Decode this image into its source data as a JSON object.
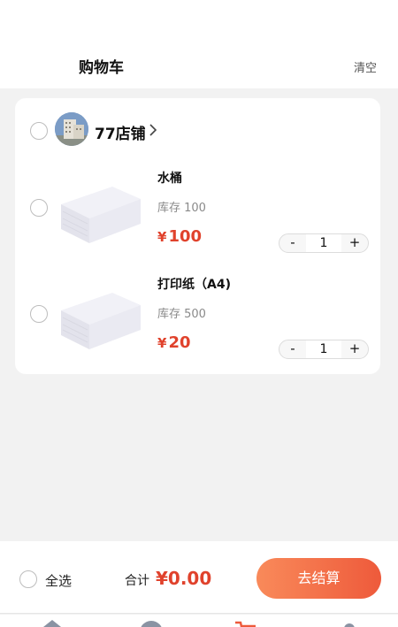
{
  "header": {
    "title": "购物车",
    "clear_label": "清空"
  },
  "store": {
    "name": "77店铺",
    "items": [
      {
        "name": "水桶",
        "stock": "库存 100",
        "currency": "¥",
        "price": "100",
        "qty": "1"
      },
      {
        "name": "打印纸（A4)",
        "stock": "库存 500",
        "currency": "¥",
        "price": "20",
        "qty": "1"
      }
    ]
  },
  "stepper": {
    "minus": "-",
    "plus": "+"
  },
  "footer": {
    "select_all": "全选",
    "total_label": "合计",
    "total_currency": "¥",
    "total_value": "0.00",
    "checkout": "去结算"
  },
  "tabbar": {
    "icons": [
      "home-icon",
      "category-icon",
      "cart-icon",
      "profile-icon"
    ]
  },
  "colors": {
    "accent": "#e0422c",
    "checkout_gradient_start": "#f98a5a",
    "checkout_gradient_end": "#ee5a3b"
  }
}
